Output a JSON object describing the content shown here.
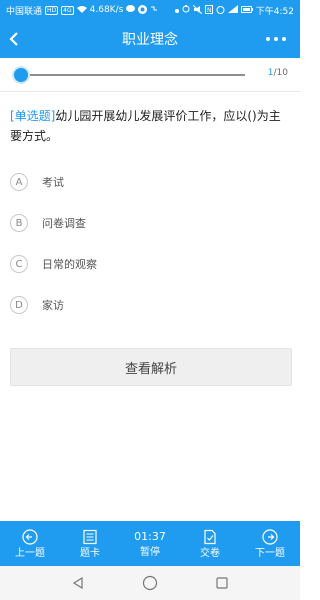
{
  "status_bar": {
    "carrier": "中国联通",
    "hd_badge": "HD",
    "net_badge": "4G",
    "speed": "4.68K/s",
    "time": "下午4:52"
  },
  "header": {
    "title": "职业理念"
  },
  "progress": {
    "current": "1",
    "separator": "/",
    "total": "10",
    "fraction": 0.0
  },
  "question": {
    "type": "[单选题]",
    "text": "幼儿园开展幼儿发展评价工作，应以()为主要方式。"
  },
  "options": [
    {
      "letter": "A",
      "text": "考试"
    },
    {
      "letter": "B",
      "text": "问卷调查"
    },
    {
      "letter": "C",
      "text": "日常的观察"
    },
    {
      "letter": "D",
      "text": "家访"
    }
  ],
  "analysis_button": "查看解析",
  "toolbar": {
    "prev": "上一题",
    "card": "题卡",
    "timer": "01:37",
    "pause": "暂停",
    "submit": "交卷",
    "next": "下一题"
  },
  "colors": {
    "accent": "#1f9bef"
  }
}
